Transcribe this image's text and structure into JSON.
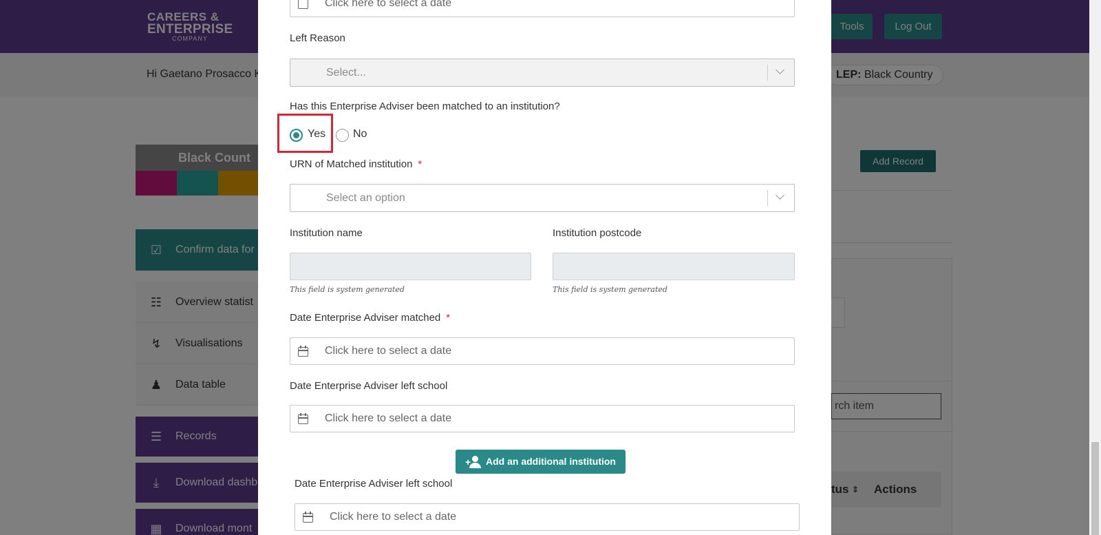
{
  "header": {
    "logo_line1": "CAREERS &",
    "logo_line2": "ENTERPRISE",
    "logo_line3": "COMPANY",
    "tools_label": "Tools",
    "logout_label": "Log Out"
  },
  "greeting": {
    "text": "Hi Gaetano Prosacco K",
    "lep_label": "LEP:",
    "lep_value": "Black Country"
  },
  "banner": {
    "title": "Black Count",
    "stripe_colors": [
      "#c2187a",
      "#2aa7a1",
      "#e5a100"
    ]
  },
  "sidebar": {
    "items": [
      {
        "label": "Confirm data for",
        "icon": "calendar-check-icon",
        "style": "teal"
      },
      {
        "label": "Overview statist",
        "icon": "magnifier-list-icon",
        "style": "grey"
      },
      {
        "label": "Visualisations",
        "icon": "chart-hand-icon",
        "style": "grey"
      },
      {
        "label": "Data table",
        "icon": "person-desk-icon",
        "style": "grey"
      },
      {
        "label": "Records",
        "icon": "checklist-icon",
        "style": "purple"
      },
      {
        "label": "Download dashb",
        "icon": "download-icon",
        "style": "purple"
      },
      {
        "label": "Download mont",
        "icon": "calendar-icon",
        "style": "purple"
      }
    ]
  },
  "right_panel": {
    "add_record_label": "Add Record",
    "search_text": "rch item",
    "status_header": "tus",
    "actions_header": "Actions"
  },
  "modal": {
    "top_date_placeholder": "Click here to select a date",
    "left_reason_label": "Left Reason",
    "left_reason_placeholder": "Select...",
    "matched_question": "Has this Enterprise Adviser been matched to an institution?",
    "radio_yes": "Yes",
    "radio_no": "No",
    "selected_option": "Yes",
    "urn_label": "URN of Matched institution",
    "required_mark": "*",
    "urn_placeholder": "Select an option",
    "institution_name_label": "Institution name",
    "institution_postcode_label": "Institution postcode",
    "system_hint": "This field is system generated",
    "date_matched_label": "Date Enterprise Adviser matched",
    "date_matched_placeholder": "Click here to select a date",
    "date_left_label": "Date Enterprise Adviser left school",
    "date_left_placeholder": "Click here to select a date",
    "add_institution_label": "Add an additional institution",
    "date_left_label_2": "Date Enterprise Adviser left school",
    "date_left_placeholder_2": "Click here to select a date"
  },
  "colors": {
    "brand_purple": "#5a3a8f",
    "teal": "#2a8a8a",
    "highlight_red": "#d0283a"
  }
}
